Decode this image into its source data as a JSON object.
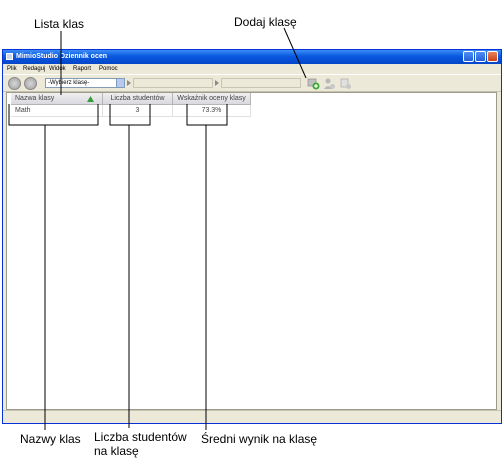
{
  "callouts": {
    "lista_klas": "Lista klas",
    "dodaj_klase": "Dodaj klasę",
    "nazwy_klas": "Nazwy klas",
    "liczba_studentow_line1": "Liczba studentów",
    "liczba_studentow_line2": "na klasę",
    "sredni_wynik": "Średni wynik na klasę"
  },
  "window": {
    "title": "MimioStudio Dziennik ocen",
    "menu": [
      "Plik",
      "Redaguj",
      "Widok",
      "Raport",
      "Pomoc"
    ],
    "toolbar": {
      "class_combo_value": "-Wybierz klasę-",
      "icons": [
        "back-icon",
        "forward-icon",
        "add-class-icon",
        "add-student-icon",
        "add-activity-icon"
      ]
    }
  },
  "grid": {
    "columns": [
      "Nazwa klasy",
      "Liczba studentów",
      "Wskaźnik oceny klasy"
    ],
    "rows": [
      {
        "name": "Math",
        "students": "3",
        "score": "73.3%"
      }
    ]
  }
}
